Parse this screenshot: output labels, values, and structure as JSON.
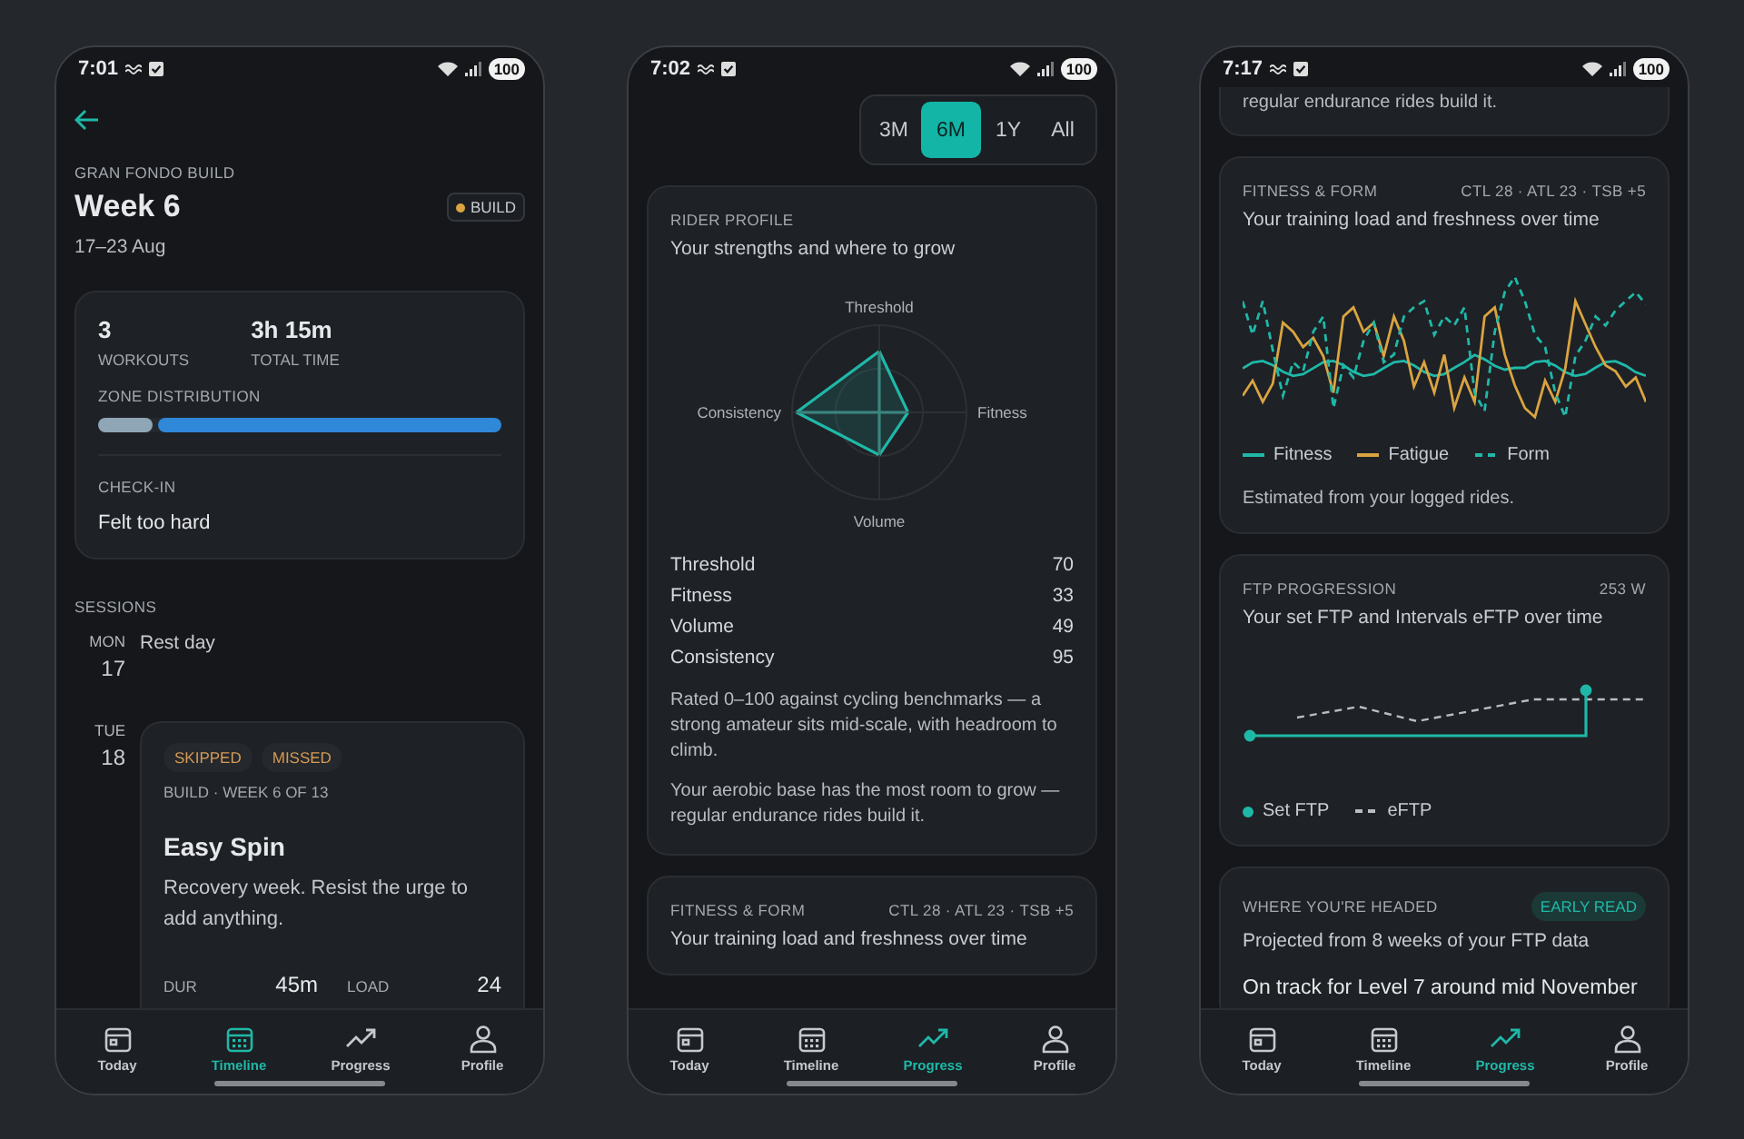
{
  "phones": [
    {
      "time": "7:01",
      "battery": "100",
      "header": {
        "eyebrow": "GRAN FONDO BUILD",
        "title": "Week 6",
        "badge": {
          "label": "BUILD",
          "color": "#d9a441"
        },
        "dates": "17–23 Aug"
      },
      "summary": {
        "stats": [
          {
            "value": "3",
            "label": "WORKOUTS"
          },
          {
            "value": "3h 15m",
            "label": "TOTAL TIME"
          }
        ],
        "zone_label": "ZONE DISTRIBUTION",
        "zones": [
          {
            "level": 0.14,
            "color": "#8fa6b6"
          },
          {
            "level": 0.86,
            "color": "#2f88d8"
          }
        ],
        "checkin_label": "CHECK-IN",
        "checkin": "Felt too hard"
      },
      "sessions_label": "SESSIONS",
      "days": [
        {
          "weekday": "MON",
          "date": "17",
          "kind": "rest",
          "text": "Rest day"
        },
        {
          "weekday": "TUE",
          "date": "18",
          "kind": "workout",
          "tags": [
            "SKIPPED",
            "MISSED"
          ],
          "meta": "BUILD · WEEK 6 OF 13",
          "title": "Easy Spin",
          "description": "Recovery week. Resist the urge to add anything.",
          "metrics": [
            {
              "label": "DUR",
              "value": "45m"
            },
            {
              "label": "LOAD",
              "value": "24"
            }
          ]
        }
      ],
      "nav": [
        {
          "label": "Today",
          "selected": false
        },
        {
          "label": "Timeline",
          "selected": true
        },
        {
          "label": "Progress",
          "selected": false
        },
        {
          "label": "Profile",
          "selected": false
        }
      ]
    },
    {
      "time": "7:02",
      "battery": "100",
      "ranges": [
        {
          "label": "3M",
          "selected": false
        },
        {
          "label": "6M",
          "selected": true
        },
        {
          "label": "1Y",
          "selected": false
        },
        {
          "label": "All",
          "selected": false
        }
      ],
      "cards": [
        {
          "kind": "profile",
          "eyebrow": "RIDER PROFILE",
          "subtitle": "Your strengths and where to grow",
          "radar": [
            {
              "label": "Threshold",
              "level": 0.7
            },
            {
              "label": "Fitness",
              "level": 0.33
            },
            {
              "label": "Volume",
              "level": 0.49
            },
            {
              "label": "Consistency",
              "level": 0.95
            }
          ],
          "scores": [
            {
              "label": "Threshold",
              "value": "70"
            },
            {
              "label": "Fitness",
              "value": "33"
            },
            {
              "label": "Volume",
              "value": "49"
            },
            {
              "label": "Consistency",
              "value": "95"
            }
          ],
          "notes": [
            "Rated 0–100 against cycling benchmarks — a strong amateur sits mid-scale, with headroom to climb.",
            "Your aerobic base has the most room to grow — regular endurance rides build it."
          ]
        },
        {
          "kind": "form",
          "eyebrow": "FITNESS & FORM",
          "summary": "CTL 28 · ATL 23 · TSB +5",
          "subtitle": "Your training load and freshness over time"
        }
      ],
      "nav": [
        {
          "label": "Today",
          "selected": false
        },
        {
          "label": "Timeline",
          "selected": false
        },
        {
          "label": "Progress",
          "selected": true
        },
        {
          "label": "Profile",
          "selected": false
        }
      ]
    },
    {
      "time": "7:17",
      "battery": "100",
      "cards": [
        {
          "kind": "tail",
          "text": "regular endurance rides build it."
        },
        {
          "kind": "form",
          "eyebrow": "FITNESS & FORM",
          "summary": "CTL 28 · ATL 23 · TSB +5",
          "subtitle": "Your training load and freshness over time",
          "legend": [
            {
              "label": "Fitness",
              "kind": "line",
              "color": "#1fb8a8"
            },
            {
              "label": "Fatigue",
              "kind": "line",
              "color": "#d9a441"
            },
            {
              "label": "Form",
              "kind": "dashed",
              "color": "#1fb8a8"
            }
          ],
          "footnote": "Estimated from your logged rides."
        },
        {
          "kind": "ftp",
          "eyebrow": "FTP PROGRESSION",
          "summary": "253 W",
          "subtitle": "Your set FTP and Intervals eFTP over time",
          "legend": [
            {
              "label": "Set FTP",
              "kind": "dot",
              "color": "#1fb8a8"
            },
            {
              "label": "eFTP",
              "kind": "dashed",
              "color": "#b9bcc1"
            }
          ]
        },
        {
          "kind": "projection",
          "eyebrow": "WHERE YOU'RE HEADED",
          "badge": "EARLY READ",
          "subtitle": "Projected from 8 weeks of your FTP data",
          "headline": "On track for Level 7 around mid November"
        }
      ],
      "nav": [
        {
          "label": "Today",
          "selected": false
        },
        {
          "label": "Timeline",
          "selected": false
        },
        {
          "label": "Progress",
          "selected": true
        },
        {
          "label": "Profile",
          "selected": false
        }
      ]
    }
  ]
}
